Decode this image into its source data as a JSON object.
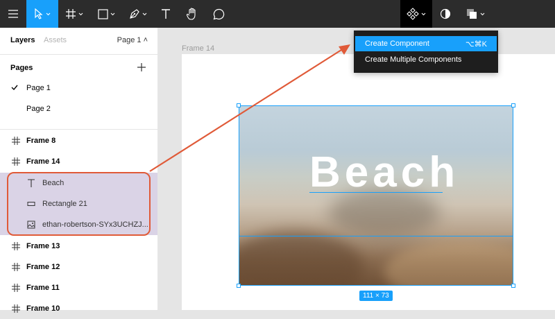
{
  "toolbar": {
    "tools": [
      "menu-icon",
      "move-icon",
      "frame-icon",
      "shape-icon",
      "pen-icon",
      "text-icon",
      "hand-icon",
      "comment-icon",
      "component-icon",
      "contrast-icon",
      "boolean-icon"
    ],
    "accent": "#18a0fb",
    "background": "#2c2c2c"
  },
  "panel": {
    "tabs": {
      "layers": "Layers",
      "assets": "Assets"
    },
    "page_select": "Page 1 ˄",
    "pages_heading": "Pages",
    "pages": [
      {
        "label": "Page 1",
        "selected": true
      },
      {
        "label": "Page 2",
        "selected": false
      }
    ],
    "layers": [
      {
        "label": "Frame 8",
        "kind": "frame"
      },
      {
        "label": "Frame 14",
        "kind": "frame"
      },
      {
        "label": "Beach",
        "kind": "text"
      },
      {
        "label": "Rectangle 21",
        "kind": "rectangle"
      },
      {
        "label": "ethan-robertson-SYx3UCHZJ...",
        "kind": "image"
      },
      {
        "label": "Frame 13",
        "kind": "frame"
      },
      {
        "label": "Frame 12",
        "kind": "frame"
      },
      {
        "label": "Frame 11",
        "kind": "frame"
      },
      {
        "label": "Frame 10",
        "kind": "frame"
      }
    ]
  },
  "canvas": {
    "frame_label": "Frame 14",
    "headline": "Beach",
    "size_badge": "111 × 73"
  },
  "dropdown": {
    "items": [
      {
        "label": "Create Component",
        "shortcut": "⌥⌘K",
        "active": true
      },
      {
        "label": "Create Multiple Components",
        "shortcut": "",
        "active": false
      }
    ]
  },
  "annotation_color": "#e05a38"
}
